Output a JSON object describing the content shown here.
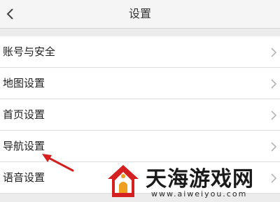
{
  "header": {
    "title": "设置",
    "back_icon": "chevron-left-icon"
  },
  "settings": {
    "items": [
      {
        "label": "账号与安全",
        "icon": "chevron-right-icon"
      },
      {
        "label": "地图设置",
        "icon": "chevron-right-icon"
      },
      {
        "label": "首页设置",
        "icon": "chevron-right-icon"
      },
      {
        "label": "导航设置",
        "icon": "chevron-right-icon"
      },
      {
        "label": "语音设置",
        "icon": "chevron-right-icon"
      }
    ]
  },
  "annotation": {
    "icon": "red-arrow-icon",
    "color": "#d42020"
  },
  "watermark": {
    "name": "天海游戏网",
    "url": "www.aiweiyou.com",
    "logo_colors": [
      "#d42020",
      "#f0a020"
    ]
  }
}
